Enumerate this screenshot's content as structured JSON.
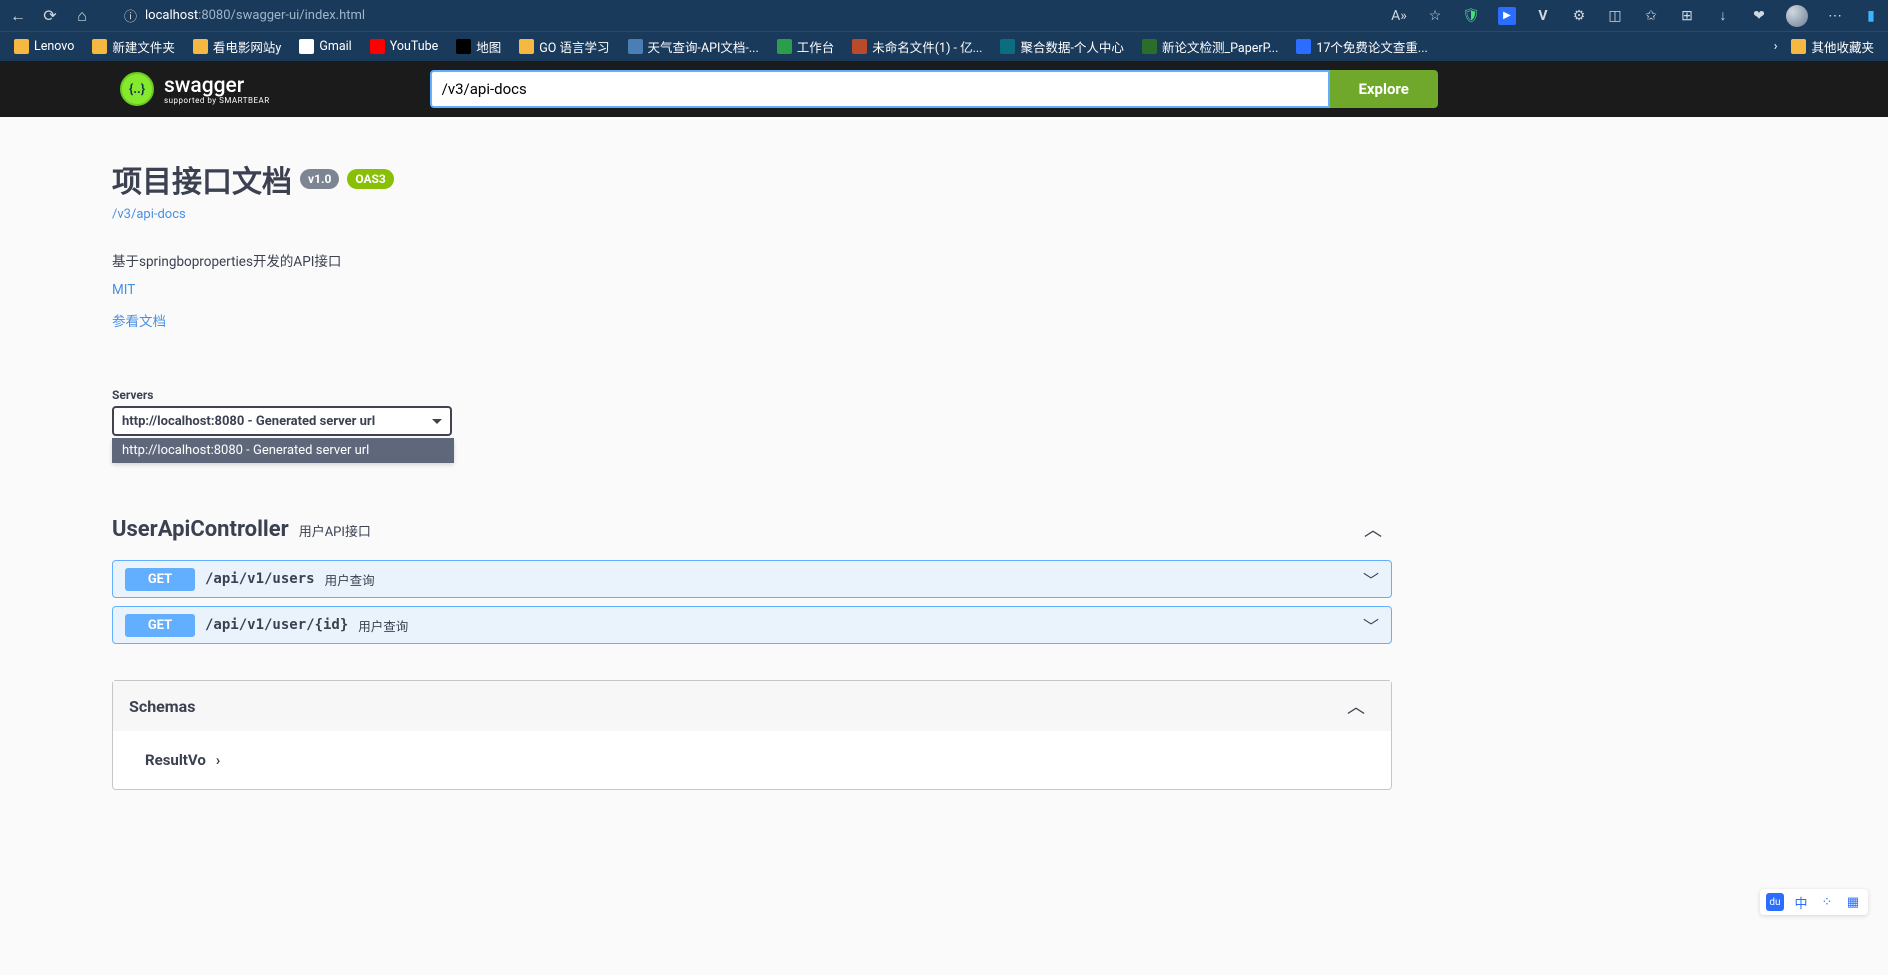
{
  "browser": {
    "url_host": "localhost",
    "url_port_path": ":8080/swagger-ui/index.html",
    "read_aloud": "A»"
  },
  "bookmarks": [
    {
      "label": "Lenovo",
      "ico": "folder"
    },
    {
      "label": "新建文件夹",
      "ico": "folder"
    },
    {
      "label": "看电影网站y",
      "ico": "folder"
    },
    {
      "label": "Gmail",
      "ico": "gmail"
    },
    {
      "label": "YouTube",
      "ico": "yt"
    },
    {
      "label": "地图",
      "ico": "map"
    },
    {
      "label": "GO 语言学习",
      "ico": "go"
    },
    {
      "label": "天气查询-API文档-...",
      "ico": "sw"
    },
    {
      "label": "工作台",
      "ico": "wk"
    },
    {
      "label": "未命名文件(1) - 亿...",
      "ico": "yi"
    },
    {
      "label": "聚合数据-个人中心",
      "ico": "ju"
    },
    {
      "label": "新论文检测_PaperP...",
      "ico": "pp"
    },
    {
      "label": "17个免费论文查重...",
      "ico": "zh"
    }
  ],
  "bookmarks_other": "其他收藏夹",
  "swagger": {
    "brand": "swagger",
    "sub": "supported by SMARTBEAR",
    "explore_input": "/v3/api-docs",
    "explore_btn": "Explore"
  },
  "info": {
    "title": "项目接口文档",
    "version": "v1.0",
    "oas": "OAS3",
    "docs_link": "/v3/api-docs",
    "description": "基于springboproperties开发的API接口",
    "license": "MIT",
    "ext_docs": "参看文档"
  },
  "servers": {
    "label": "Servers",
    "selected": "http://localhost:8080 - Generated server url",
    "option": "http://localhost:8080 - Generated server url"
  },
  "tag": {
    "name": "UserApiController",
    "desc": "用户API接口"
  },
  "ops": [
    {
      "method": "GET",
      "path": "/api/v1/users",
      "desc": "用户查询"
    },
    {
      "method": "GET",
      "path": "/api/v1/user/{id}",
      "desc": "用户查询"
    }
  ],
  "schemas": {
    "title": "Schemas",
    "item": "ResultVo"
  },
  "float": {
    "cn": "中"
  }
}
